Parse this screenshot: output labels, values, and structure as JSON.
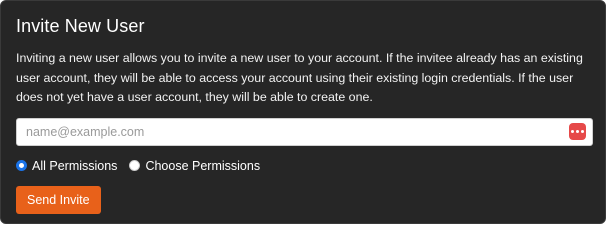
{
  "invite": {
    "title": "Invite New User",
    "description": "Inviting a new user allows you to invite a new user to your account. If the invitee already has an existing user account, they will be able to access your account using their existing login credentials. If the user does not yet have a user account, they will be able to create one.",
    "email": {
      "placeholder": "name@example.com",
      "value": "",
      "icon": "password-manager-icon"
    },
    "permissions": {
      "selected": "all",
      "options": [
        {
          "label": "All Permissions",
          "checked": true
        },
        {
          "label": "Choose Permissions",
          "checked": false
        }
      ]
    },
    "send_label": "Send Invite"
  },
  "colors": {
    "panel_bg": "#262626",
    "accent": "#e8611a",
    "radio_selected": "#1a73e8",
    "icon_bg": "#e64949"
  }
}
